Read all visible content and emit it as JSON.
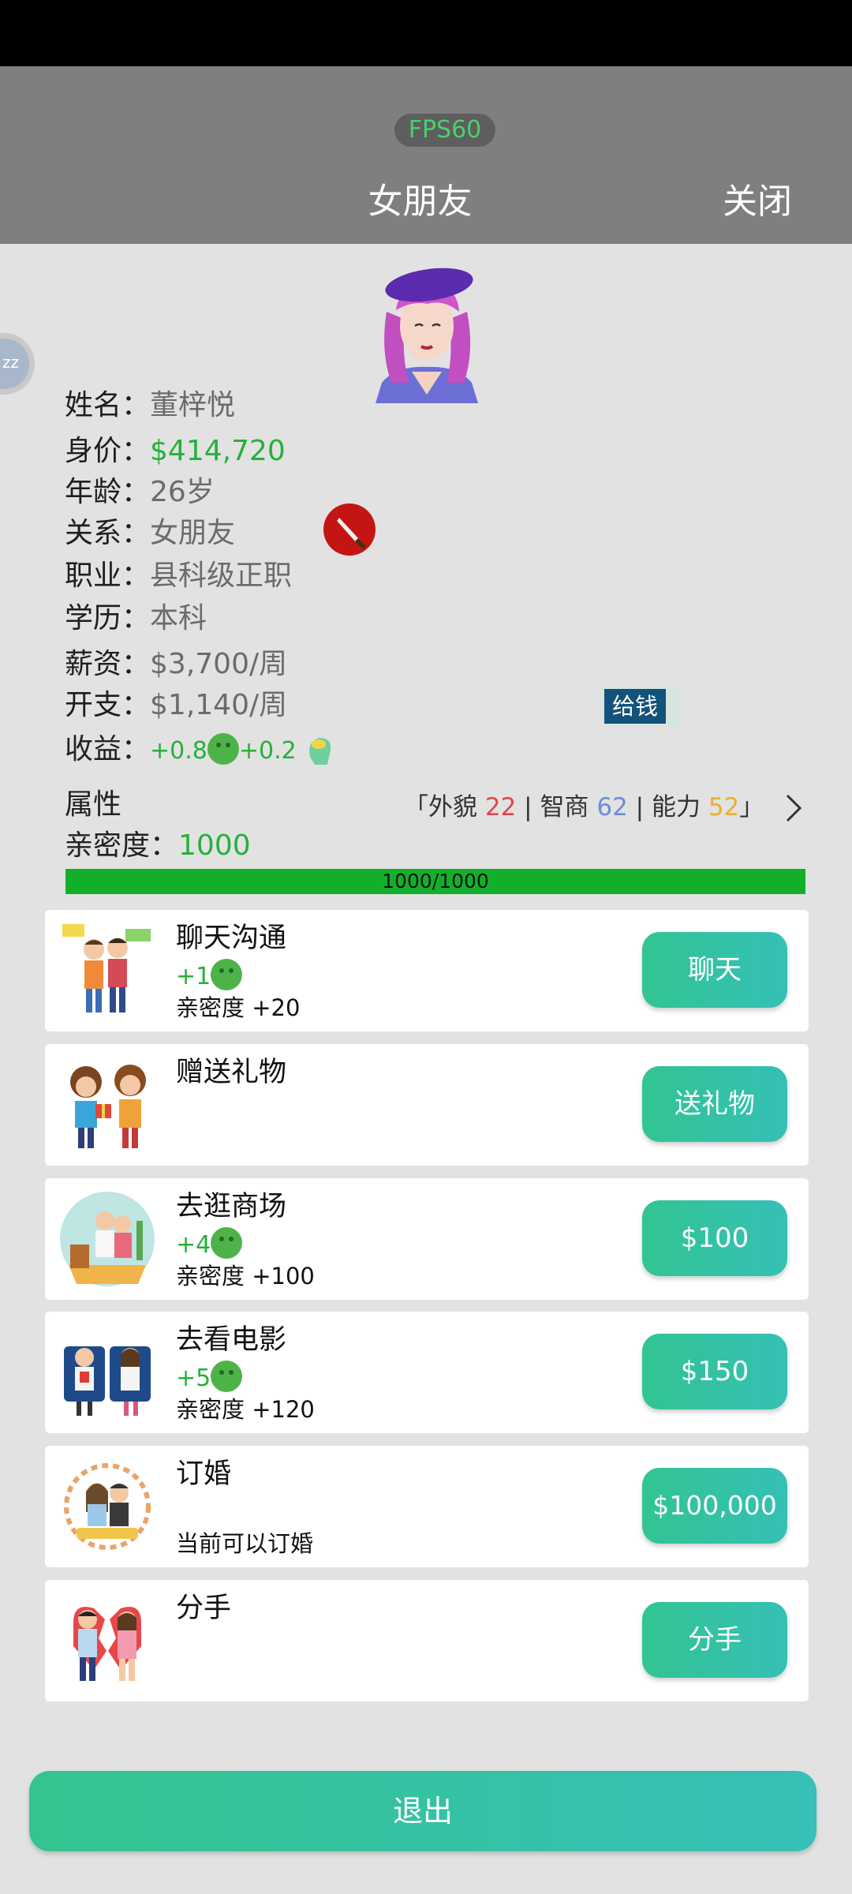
{
  "header": {
    "fps": "FPS60",
    "title": "女朋友",
    "close": "关闭"
  },
  "side_bubble": "zz",
  "profile": {
    "name_k": "姓名：",
    "name_v": "董梓悦",
    "worth_k": "身价：",
    "worth_v": "$414,720",
    "age_k": "年龄：",
    "age_v": "26岁",
    "rel_k": "关系：",
    "rel_v": "女朋友",
    "job_k": "职业：",
    "job_v": "县科级正职",
    "edu_k": "学历：",
    "edu_v": "本科",
    "salary_k": "薪资：",
    "salary_v": "$3,700/周",
    "expense_k": "开支：",
    "expense_v": "$1,140/周",
    "give_money": "给钱",
    "earn_k": "收益：",
    "earn_a": "+0.8",
    "earn_b": "+0.2"
  },
  "attributes": {
    "label": "属性",
    "open": "「外貌",
    "looks": "22",
    "sep1": "| 智商",
    "iq": "62",
    "sep2": "| 能力",
    "ability": "52",
    "close": "」",
    "intimacy_k": "亲密度：",
    "intimacy_v": "1000",
    "bar_text": "1000/1000",
    "bar_fraction": 1.0
  },
  "actions": [
    {
      "name": "聊天沟通",
      "gain": "+1",
      "intimacy": "亲密度 +20",
      "button": "聊天"
    },
    {
      "name": "赠送礼物",
      "gain": "",
      "intimacy": "",
      "button": "送礼物"
    },
    {
      "name": "去逛商场",
      "gain": "+4",
      "intimacy": "亲密度 +100",
      "button": "$100"
    },
    {
      "name": "去看电影",
      "gain": "+5",
      "intimacy": "亲密度 +120",
      "button": "$150"
    },
    {
      "name": "订婚",
      "gain": "",
      "intimacy": "当前可以订婚",
      "button": "$100,000"
    },
    {
      "name": "分手",
      "gain": "",
      "intimacy": "",
      "button": "分手"
    }
  ],
  "exit": "退出",
  "colors": {
    "header": "#7f7f7f",
    "accent": "#34c3a0",
    "green": "#26b03a",
    "bg": "#e2e2e2"
  }
}
